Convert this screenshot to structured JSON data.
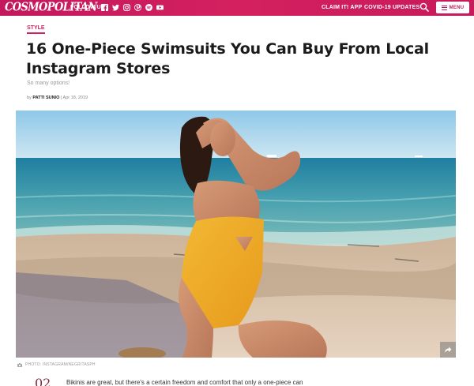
{
  "nav": {
    "brand": "COSMOPOLITAN",
    "follow_label": "FOLLOW US!",
    "socials": [
      {
        "icon": "facebook-icon"
      },
      {
        "icon": "twitter-icon"
      },
      {
        "icon": "instagram-icon"
      },
      {
        "icon": "pinterest-icon"
      },
      {
        "icon": "spotify-icon"
      },
      {
        "icon": "youtube-icon"
      }
    ],
    "claim_label": "CLAIM IT! APP",
    "covid_label": "COVID-19 UPDATES",
    "search_icon": "search-icon",
    "menu_label": "MENU",
    "bar_color": "#c3185d"
  },
  "article": {
    "category": "STYLE",
    "headline": "16 One-Piece Swimsuits You Can Buy From Local Instagram Stores",
    "dek": "So many options!",
    "byline_prefix": "by",
    "author": "PATTI SUNIO",
    "date": "| Apr 18, 2019",
    "image_credit": "PHOTO: INSTAGRAM/NEGRITASPH",
    "intro_number": "02",
    "intro_text": "Bikinis are great, but there's a certain freedom and comfort that only a one-piece can",
    "accent_color": "#d4205f"
  }
}
